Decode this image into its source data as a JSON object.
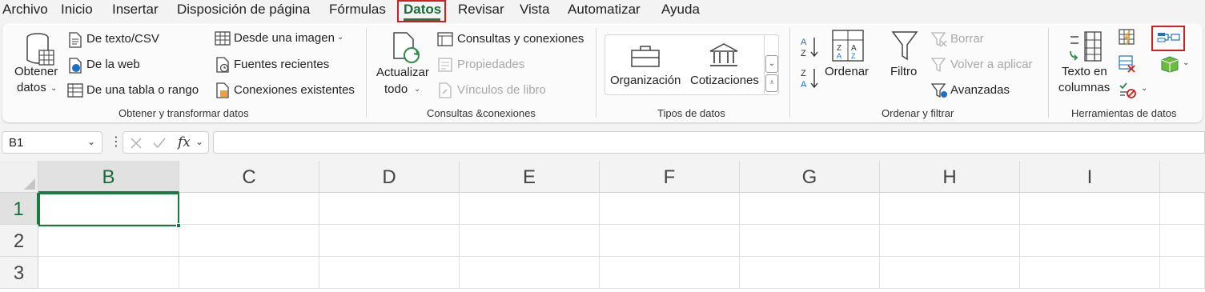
{
  "menu": [
    "Archivo",
    "Inicio",
    "Insertar",
    "Disposición de página",
    "Fórmulas",
    "Datos",
    "Revisar",
    "Vista",
    "Automatizar",
    "Ayuda"
  ],
  "ribbon": {
    "obtener": {
      "button_line1": "Obtener",
      "button_line2": "datos",
      "items": [
        "De texto/CSV",
        "De la web",
        "De una tabla o rango"
      ],
      "items2": [
        "Desde una imagen",
        "Fuentes recientes",
        "Conexiones existentes"
      ],
      "label": "Obtener y transformar datos"
    },
    "consultas": {
      "button_line1": "Actualizar",
      "button_line2": "todo",
      "items": [
        "Consultas y conexiones",
        "Propiedades",
        "Vínculos de libro"
      ],
      "label": "Consultas &conexiones"
    },
    "tipos": {
      "items": [
        "Organización",
        "Cotizaciones"
      ],
      "label": "Tipos de datos"
    },
    "ordenar": {
      "ordenar": "Ordenar",
      "filtro": "Filtro",
      "items": [
        "Borrar",
        "Volver a aplicar",
        "Avanzadas"
      ],
      "label": "Ordenar y filtrar"
    },
    "herramientas": {
      "button_line1": "Texto en",
      "button_line2": "columnas",
      "label": "Herramientas de datos"
    }
  },
  "formula_bar": {
    "name_box": "B1",
    "fx": "fx",
    "value": ""
  },
  "grid": {
    "columns": [
      "B",
      "C",
      "D",
      "E",
      "F",
      "G",
      "H",
      "I"
    ],
    "rows": [
      "1",
      "2",
      "3"
    ],
    "active_cell": "B1"
  },
  "colors": {
    "accent_green": "#1a7a40",
    "highlight_red": "#d11f1f"
  }
}
